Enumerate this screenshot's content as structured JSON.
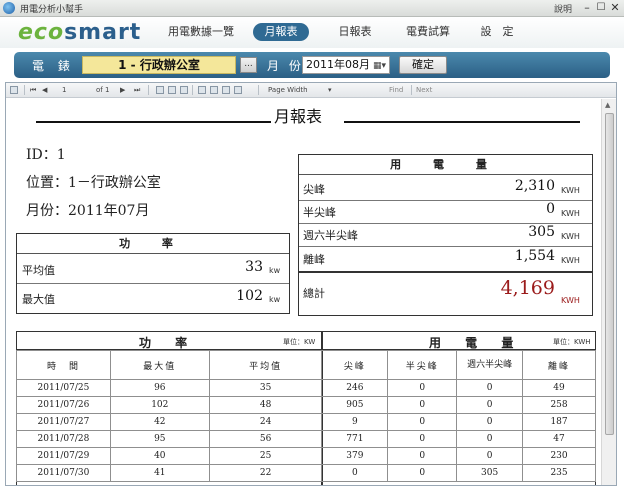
{
  "window": {
    "title": "用電分析小幫手",
    "help": "說明",
    "min": "–",
    "max": "☐",
    "close": "✕"
  },
  "brand": {
    "eco": "eco",
    "smart": "smart"
  },
  "nav": [
    {
      "label": "用電數據一覽"
    },
    {
      "label": "月報表"
    },
    {
      "label": "日報表"
    },
    {
      "label": "電費試算"
    },
    {
      "label": "設　定"
    }
  ],
  "filter": {
    "meter_label": "電 錶",
    "meter_value": "1 - 行政辦公室",
    "meter_btn": "...",
    "month_label": "月 份",
    "month_value": "2011年08月",
    "month_icon": "▦▾",
    "confirm": "確定"
  },
  "toolbar": {
    "page": "1",
    "of": "of 1",
    "zoom": "Page Width",
    "find": "Find",
    "next": "Next",
    "first": "⏮",
    "prev": "◀",
    "nextp": "▶",
    "last": "⏭"
  },
  "report": {
    "title": "月報表",
    "id_line": "ID：1",
    "location_line": "位置：1－行政辦公室",
    "month_line": "月份：2011年07月",
    "power_box": {
      "title": "功 率",
      "rows": [
        {
          "label": "平均值",
          "value": "33",
          "unit": "kw"
        },
        {
          "label": "最大值",
          "value": "102",
          "unit": "kw"
        }
      ]
    },
    "energy_box": {
      "title": "用 電 量",
      "rows": [
        {
          "label": "尖峰",
          "value": "2,310",
          "unit": "KWH"
        },
        {
          "label": "半尖峰",
          "value": "0",
          "unit": "KWH"
        },
        {
          "label": "週六半尖峰",
          "value": "305",
          "unit": "KWH"
        },
        {
          "label": "離峰",
          "value": "1,554",
          "unit": "KWH"
        }
      ],
      "total_label": "總計",
      "total_value": "4,169",
      "total_unit": "KWH",
      "total_color": "#9b1b1b"
    },
    "table": {
      "power_title": "功 率",
      "power_unit": "單位：KW",
      "energy_title": "用 電 量",
      "energy_unit": "單位：KWH",
      "headers": [
        "時　間",
        "最大值",
        "平均值",
        "尖峰",
        "半尖峰",
        "週六半尖峰",
        "離峰"
      ],
      "rows": [
        [
          "2011/07/25",
          "96",
          "35",
          "246",
          "0",
          "0",
          "49"
        ],
        [
          "2011/07/26",
          "102",
          "48",
          "905",
          "0",
          "0",
          "258"
        ],
        [
          "2011/07/27",
          "42",
          "24",
          "9",
          "0",
          "0",
          "187"
        ],
        [
          "2011/07/28",
          "95",
          "56",
          "771",
          "0",
          "0",
          "47"
        ],
        [
          "2011/07/29",
          "40",
          "25",
          "379",
          "0",
          "0",
          "230"
        ],
        [
          "2011/07/30",
          "41",
          "22",
          "0",
          "0",
          "305",
          "235"
        ]
      ]
    }
  }
}
